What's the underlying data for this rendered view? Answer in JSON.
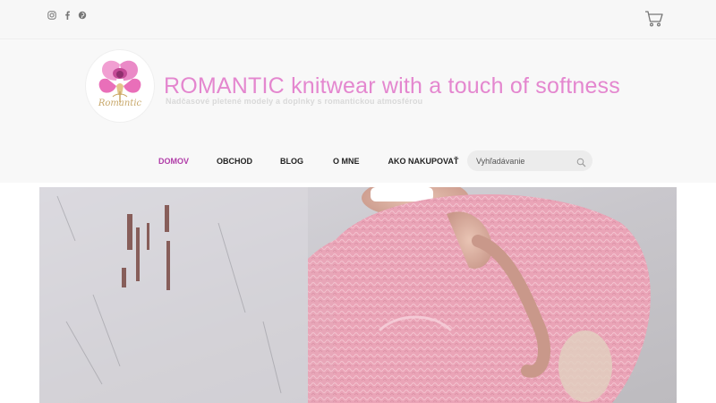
{
  "header": {
    "title": "ROMANTIC knitwear with a touch of softness",
    "tagline": "Nadčasové pletené modely a doplnky s romantickou atmosférou"
  },
  "logo": {
    "text": "Romantic"
  },
  "social": [
    "instagram-icon",
    "facebook-icon",
    "pinterest-icon"
  ],
  "nav": {
    "items": [
      {
        "label": "DOMOV",
        "active": true
      },
      {
        "label": "OBCHOD",
        "active": false
      },
      {
        "label": "BLOG",
        "active": false
      },
      {
        "label": "O MNE",
        "active": false
      },
      {
        "label": "AKO NAKUPOVAŤ",
        "active": false
      }
    ]
  },
  "search": {
    "placeholder": "Vyhľadávanie"
  },
  "colors": {
    "title": "#e487cf",
    "nav_active": "#b03ca8",
    "knit": "#ecaab8"
  }
}
